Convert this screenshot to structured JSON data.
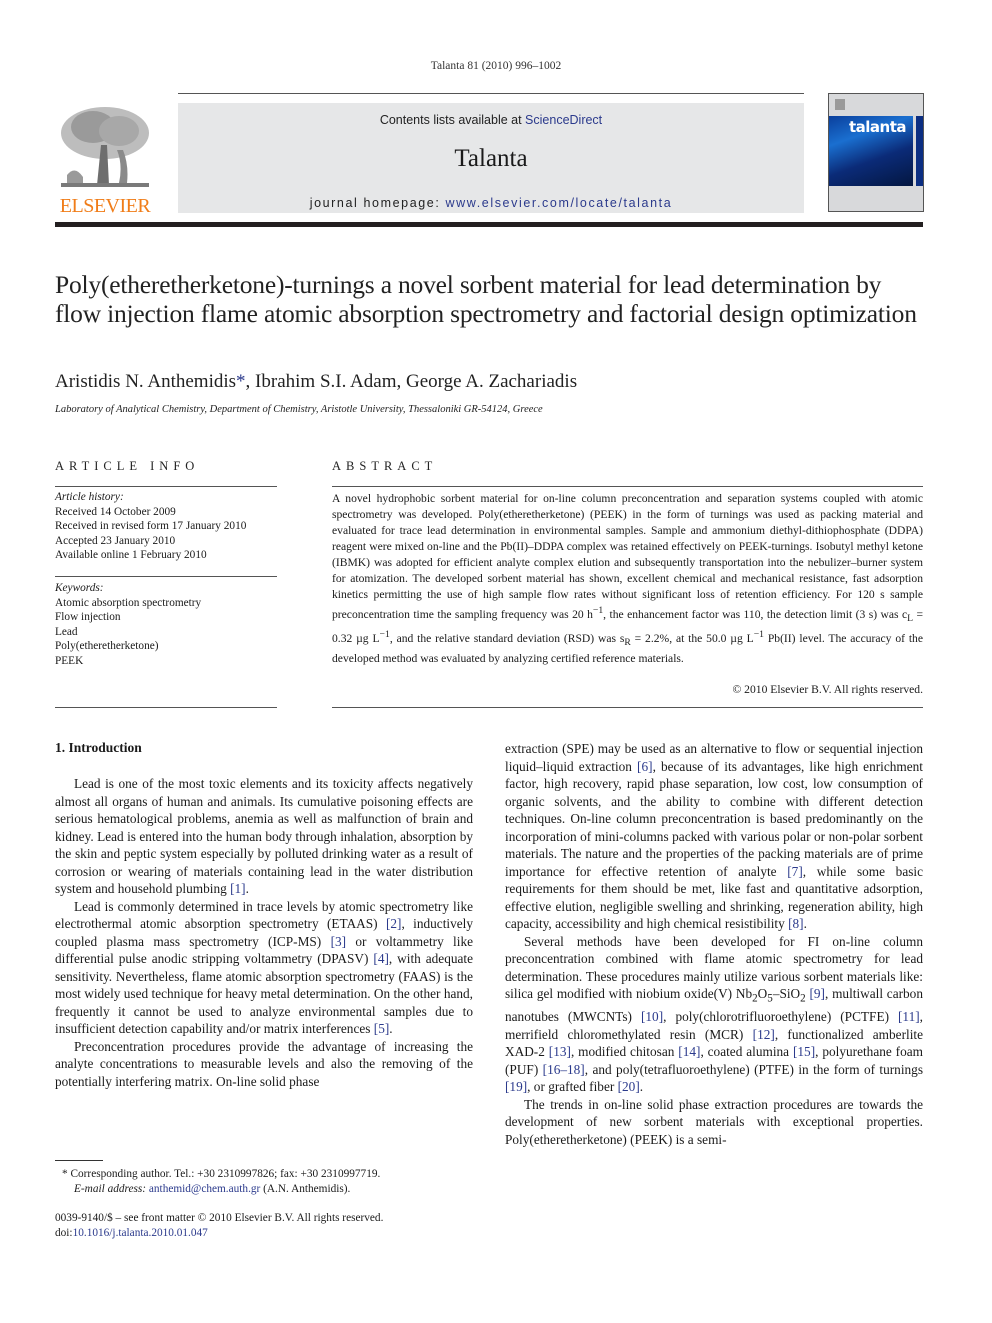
{
  "running_head": "Talanta 81 (2010) 996–1002",
  "masthead": {
    "publisher_logo_text": "ELSEVIER",
    "contents_prefix": "Contents lists available at ",
    "contents_link": "ScienceDirect",
    "journal_name": "Talanta",
    "homepage_prefix": "journal homepage: ",
    "homepage_link": "www.elsevier.com/locate/talanta",
    "cover_title": "talanta",
    "colors": {
      "elsevier_orange": "#f07d19",
      "link_blue": "#2b3a8c",
      "box_gray": "#e6e7e8"
    }
  },
  "article": {
    "title": "Poly(etheretherketone)-turnings a novel sorbent material for lead determination by flow injection flame atomic absorption spectrometry and factorial design optimization",
    "authors": {
      "first": "Aristidis N. Anthemidis",
      "corresponding_mark": "*",
      "rest": ", Ibrahim S.I. Adam, George A. Zachariadis"
    },
    "affiliation": "Laboratory of Analytical Chemistry, Department of Chemistry, Aristotle University, Thessaloniki GR-54124, Greece"
  },
  "article_info": {
    "heading": "ARTICLE INFO",
    "history_label": "Article history:",
    "history": [
      "Received 14 October 2009",
      "Received in revised form 17 January 2010",
      "Accepted 23 January 2010",
      "Available online 1 February 2010"
    ],
    "keywords_label": "Keywords:",
    "keywords": [
      "Atomic absorption spectrometry",
      "Flow injection",
      "Lead",
      "Poly(etheretherketone)",
      "PEEK"
    ]
  },
  "abstract": {
    "heading": "ABSTRACT",
    "text_part1": "A novel hydrophobic sorbent material for on-line column preconcentration and separation systems coupled with atomic spectrometry was developed. Poly(etheretherketone) (PEEK) in the form of turnings was used as packing material and evaluated for trace lead determination in environmental samples. Sample and ammonium diethyl-dithiophosphate (DDPA) reagent were mixed on-line and the Pb(II)–DDPA complex was retained effectively on PEEK-turnings. Isobutyl methyl ketone (IBMK) was adopted for efficient analyte complex elution and subsequently transportation into the nebulizer–burner system for atomization. The developed sorbent material has shown, excellent chemical and mechanical resistance, fast adsorption kinetics permitting the use of high sample flow rates without significant loss of retention efficiency. For 120 s sample preconcentration time the sampling frequency was 20 h",
    "sup_minus1": "−1",
    "text_part2": ", the enhancement factor was 110, the detection limit (3 s) was c",
    "sub_L": "L",
    "text_part3": " = 0.32 µg L",
    "text_part4": ", and the relative standard deviation (RSD) was s",
    "sub_R": "R",
    "text_part5": " = 2.2%, at the 50.0 µg L",
    "text_part6": " Pb(II) level. The accuracy of the developed method was evaluated by analyzing certified reference materials.",
    "copyright": "© 2010 Elsevier B.V. All rights reserved."
  },
  "introduction": {
    "heading": "1.  Introduction",
    "p1_text": "Lead is one of the most toxic elements and its toxicity affects negatively almost all organs of human and animals. Its cumulative poisoning effects are serious hematological problems, anemia as well as malfunction of brain and kidney. Lead is entered into the human body through inhalation, absorption by the skin and peptic system especially by polluted drinking water as a result of corrosion or wearing of materials containing lead in the water distribution system and household plumbing ",
    "p1_ref": "[1]",
    "p2_a": "Lead is commonly determined in trace levels by atomic spectrometry like electrothermal atomic absorption spectrometry (ETAAS) ",
    "p2_ref2": "[2]",
    "p2_b": ", inductively coupled plasma mass spectrometry (ICP-MS) ",
    "p2_ref3": "[3]",
    "p2_c": " or voltammetry like differential pulse anodic stripping voltammetry (DPASV) ",
    "p2_ref4": "[4]",
    "p2_d": ", with adequate sensitivity. Nevertheless, flame atomic absorption spectrometry (FAAS) is the most widely used technique for heavy metal determination. On the other hand, frequently it cannot be used to analyze environmental samples due to insufficient detection capability and/or matrix interferences ",
    "p2_ref5": "[5]",
    "p3_text": "Preconcentration procedures provide the advantage of increasing the analyte concentrations to measurable levels and also the removing of the potentially interfering matrix. On-line solid phase",
    "r1_a": "extraction (SPE) may be used as an alternative to flow or sequential injection liquid–liquid extraction ",
    "r1_ref6": "[6]",
    "r1_b": ", because of its advantages, like high enrichment factor, high recovery, rapid phase separation, low cost, low consumption of organic solvents, and the ability to combine with different detection techniques. On-line column preconcentration is based predominantly on the incorporation of mini-columns packed with various polar or non-polar sorbent materials. The nature and the properties of the packing materials are of prime importance for effective retention of analyte ",
    "r1_ref7": "[7]",
    "r1_c": ", while some basic requirements for them should be met, like fast and quantitative adsorption, effective elution, negligible swelling and shrinking, regeneration ability, high capacity, accessibility and high chemical resistibility ",
    "r1_ref8": "[8]",
    "r2_a": "Several methods have been developed for FI on-line column preconcentration combined with flame atomic spectrometry for lead determination. These procedures mainly utilize various sorbent materials like: silica gel modified with niobium oxide(V) Nb",
    "r2_sub2": "2",
    "r2_o": "O",
    "r2_sub5": "5",
    "r2_sio": "–SiO",
    "r2_sub2b": "2",
    "r2_ref9": "[9]",
    "r2_b": ", multiwall carbon nanotubes (MWCNTs) ",
    "r2_ref10": "[10]",
    "r2_c": ", poly(chlorotrifluoroethylene) (PCTFE) ",
    "r2_ref11": "[11]",
    "r2_d": ", merrifield chloromethylated resin (MCR) ",
    "r2_ref12": "[12]",
    "r2_e": ", functionalized amberlite XAD-2 ",
    "r2_ref13": "[13]",
    "r2_f": ", modified chitosan ",
    "r2_ref14": "[14]",
    "r2_g": ", coated alumina ",
    "r2_ref15": "[15]",
    "r2_h": ", polyurethane foam (PUF) ",
    "r2_ref16": "[16–18]",
    "r2_i": ", and poly(tetrafluoroethylene) (PTFE) in the form of turnings ",
    "r2_ref19": "[19]",
    "r2_j": ", or grafted fiber ",
    "r2_ref20": "[20]",
    "r3_text": "The trends in on-line solid phase extraction procedures are towards the development of new sorbent materials with exceptional properties. Poly(etheretherketone) (PEEK) is a semi-"
  },
  "footnote": {
    "mark": "*",
    "corresponding": " Corresponding author. Tel.: +30 2310997826; fax: +30 2310997719.",
    "email_label": "E-mail address:",
    "email": "anthemid@chem.auth.gr",
    "email_suffix": " (A.N. Anthemidis)."
  },
  "issn_line": "0039-9140/$ – see front matter © 2010 Elsevier B.V. All rights reserved.",
  "doi_prefix": "doi:",
  "doi": "10.1016/j.talanta.2010.01.047"
}
